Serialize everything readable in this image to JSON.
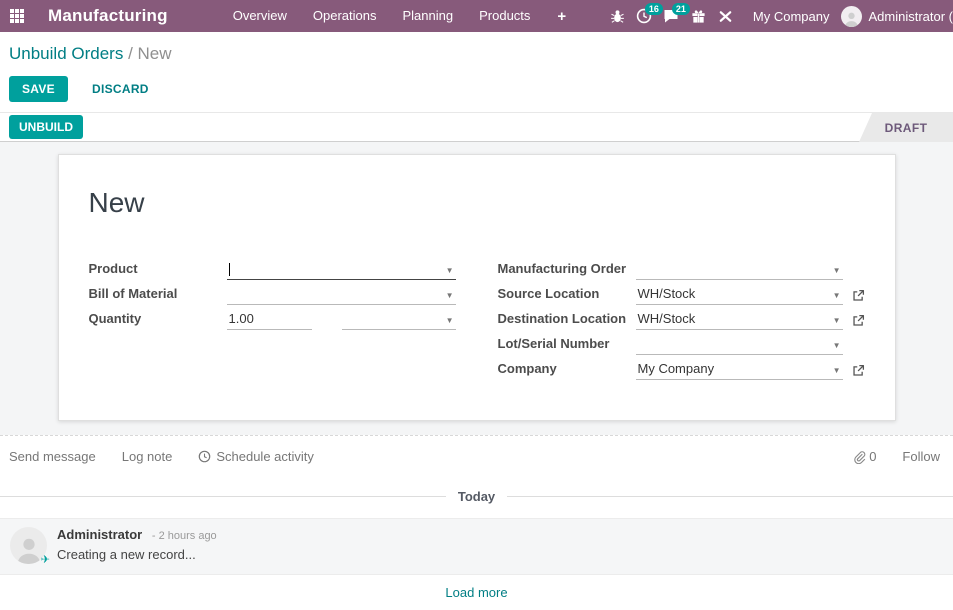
{
  "colors": {
    "nav-bg": "#875A7B",
    "accent": "#00A09D",
    "link": "#017E84",
    "status-text": "#6d597a",
    "content-bg": "#f4f5f6"
  },
  "nav": {
    "app_title": "Manufacturing",
    "menu_items": [
      "Overview",
      "Operations",
      "Planning",
      "Products"
    ],
    "plus_label": "+",
    "badges": {
      "activities": "16",
      "messages": "21"
    },
    "company": "My Company",
    "user": "Administrator ("
  },
  "breadcrumb": {
    "parent": "Unbuild Orders",
    "separator": "/",
    "current": "New"
  },
  "actions": {
    "save": "SAVE",
    "discard": "DISCARD"
  },
  "statusbar": {
    "unbuild": "UNBUILD",
    "status": "DRAFT"
  },
  "form": {
    "title": "New",
    "left": {
      "product_label": "Product",
      "product_value": "",
      "bom_label": "Bill of Material",
      "bom_value": "",
      "quantity_label": "Quantity",
      "quantity_value": "1.00",
      "uom_value": ""
    },
    "right": {
      "mo_label": "Manufacturing Order",
      "mo_value": "",
      "source_label": "Source Location",
      "source_value": "WH/Stock",
      "dest_label": "Destination Location",
      "dest_value": "WH/Stock",
      "lot_label": "Lot/Serial Number",
      "lot_value": "",
      "company_label": "Company",
      "company_value": "My Company"
    }
  },
  "chatter": {
    "send_message": "Send message",
    "log_note": "Log note",
    "schedule_activity": "Schedule activity",
    "attachment_count": "0",
    "follow": "Follow",
    "date_divider": "Today",
    "message": {
      "author": "Administrator",
      "time": "- 2 hours ago",
      "body": "Creating a new record..."
    },
    "load_more": "Load more"
  }
}
